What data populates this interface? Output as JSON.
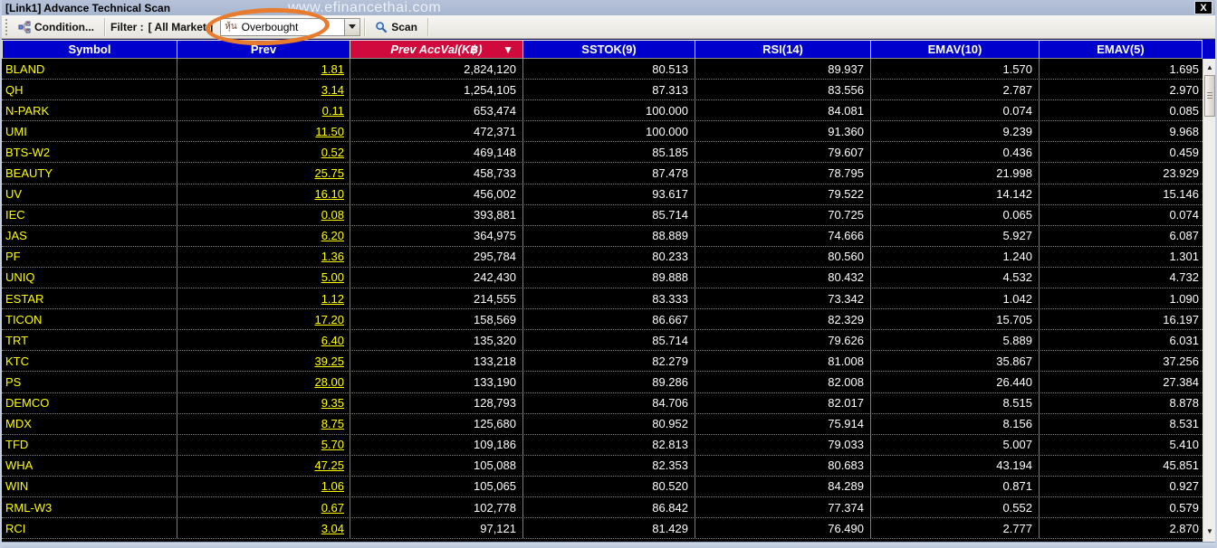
{
  "window": {
    "title": "[Link1] Advance Technical Scan",
    "watermark": "www.efinancethai.com",
    "close_glyph": "X"
  },
  "toolbar": {
    "condition_label": "Condition...",
    "filter_label": "Filter :",
    "filter_value": "[ All Market ]",
    "scan_type": {
      "icon_text": "หุ้น",
      "value": "Overbought"
    },
    "scan_label": "Scan"
  },
  "icons": {
    "sort_desc": "▼",
    "scroll_up": "▲",
    "scroll_down": "▼"
  },
  "annotation": {
    "shape": "ellipse",
    "color": "#e87c2e",
    "highlights": "scan-type-dropdown"
  },
  "colors": {
    "header_blue": "#0000cc",
    "header_sorted_red": "#d00a3c",
    "symbol_yellow": "#ffff00",
    "value_white": "#ffffff",
    "titlebar": "#aebcd6"
  },
  "table": {
    "columns": [
      {
        "label": "Symbol",
        "sorted": false
      },
      {
        "label": "Prev",
        "sorted": false
      },
      {
        "label": "Prev AccVal(K฿)",
        "sorted": true
      },
      {
        "label": "SSTOK(9)",
        "sorted": false
      },
      {
        "label": "RSI(14)",
        "sorted": false
      },
      {
        "label": "EMAV(10)",
        "sorted": false
      },
      {
        "label": "EMAV(5)",
        "sorted": false
      }
    ],
    "rows": [
      [
        "BLAND",
        "1.81",
        "2,824,120",
        "80.513",
        "89.937",
        "1.570",
        "1.695"
      ],
      [
        "QH",
        "3.14",
        "1,254,105",
        "87.313",
        "83.556",
        "2.787",
        "2.970"
      ],
      [
        "N-PARK",
        "0.11",
        "653,474",
        "100.000",
        "84.081",
        "0.074",
        "0.085"
      ],
      [
        "UMI",
        "11.50",
        "472,371",
        "100.000",
        "91.360",
        "9.239",
        "9.968"
      ],
      [
        "BTS-W2",
        "0.52",
        "469,148",
        "85.185",
        "79.607",
        "0.436",
        "0.459"
      ],
      [
        "BEAUTY",
        "25.75",
        "458,733",
        "87.478",
        "78.795",
        "21.998",
        "23.929"
      ],
      [
        "UV",
        "16.10",
        "456,002",
        "93.617",
        "79.522",
        "14.142",
        "15.146"
      ],
      [
        "IEC",
        "0.08",
        "393,881",
        "85.714",
        "70.725",
        "0.065",
        "0.074"
      ],
      [
        "JAS",
        "6.20",
        "364,975",
        "88.889",
        "74.666",
        "5.927",
        "6.087"
      ],
      [
        "PF",
        "1.36",
        "295,784",
        "80.233",
        "80.560",
        "1.240",
        "1.301"
      ],
      [
        "UNIQ",
        "5.00",
        "242,430",
        "89.888",
        "80.432",
        "4.532",
        "4.732"
      ],
      [
        "ESTAR",
        "1.12",
        "214,555",
        "83.333",
        "73.342",
        "1.042",
        "1.090"
      ],
      [
        "TICON",
        "17.20",
        "158,569",
        "86.667",
        "82.329",
        "15.705",
        "16.197"
      ],
      [
        "TRT",
        "6.40",
        "135,320",
        "85.714",
        "79.626",
        "5.889",
        "6.031"
      ],
      [
        "KTC",
        "39.25",
        "133,218",
        "82.279",
        "81.008",
        "35.867",
        "37.256"
      ],
      [
        "PS",
        "28.00",
        "133,190",
        "89.286",
        "82.008",
        "26.440",
        "27.384"
      ],
      [
        "DEMCO",
        "9.35",
        "128,793",
        "84.706",
        "82.017",
        "8.515",
        "8.878"
      ],
      [
        "MDX",
        "8.75",
        "125,680",
        "80.952",
        "75.914",
        "8.156",
        "8.531"
      ],
      [
        "TFD",
        "5.70",
        "109,186",
        "82.813",
        "79.033",
        "5.007",
        "5.410"
      ],
      [
        "WHA",
        "47.25",
        "105,088",
        "82.353",
        "80.683",
        "43.194",
        "45.851"
      ],
      [
        "WIN",
        "1.06",
        "105,065",
        "80.520",
        "84.289",
        "0.871",
        "0.927"
      ],
      [
        "RML-W3",
        "0.67",
        "102,778",
        "86.842",
        "77.374",
        "0.552",
        "0.579"
      ],
      [
        "RCI",
        "3.04",
        "97,121",
        "81.429",
        "76.490",
        "2.777",
        "2.870"
      ]
    ]
  }
}
